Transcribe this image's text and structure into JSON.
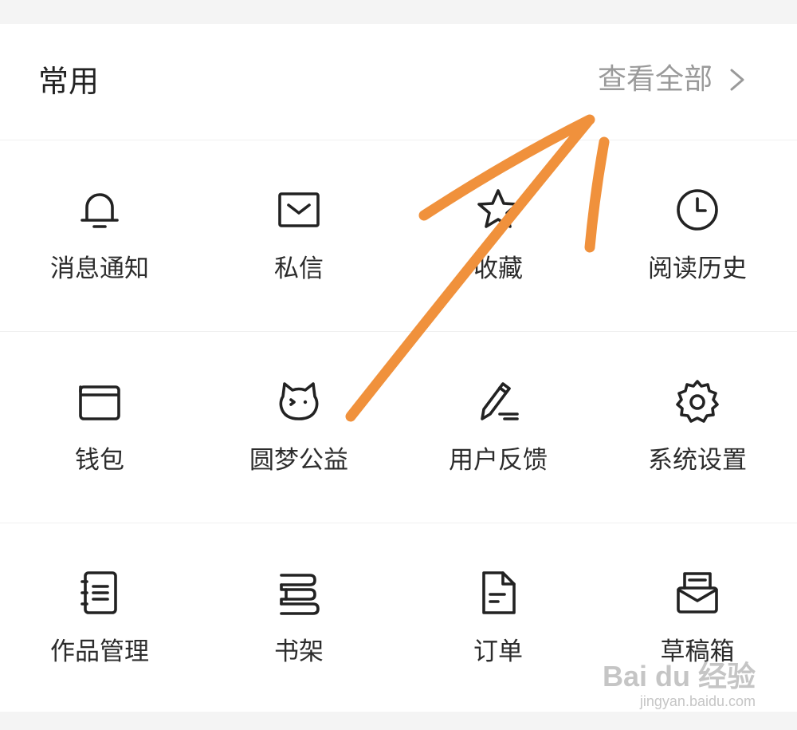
{
  "header": {
    "title": "常用",
    "view_all_label": "查看全部"
  },
  "grid": {
    "row1": [
      {
        "label": "消息通知",
        "icon": "bell-icon"
      },
      {
        "label": "私信",
        "icon": "mail-icon"
      },
      {
        "label": "收藏",
        "icon": "star-icon"
      },
      {
        "label": "阅读历史",
        "icon": "clock-icon"
      }
    ],
    "row2": [
      {
        "label": "钱包",
        "icon": "wallet-icon"
      },
      {
        "label": "圆梦公益",
        "icon": "cat-face-icon"
      },
      {
        "label": "用户反馈",
        "icon": "pencil-icon"
      },
      {
        "label": "系统设置",
        "icon": "gear-icon"
      }
    ],
    "row3": [
      {
        "label": "作品管理",
        "icon": "notebook-icon"
      },
      {
        "label": "书架",
        "icon": "bookshelf-icon"
      },
      {
        "label": "订单",
        "icon": "document-icon"
      },
      {
        "label": "草稿箱",
        "icon": "draft-box-icon"
      }
    ]
  },
  "annotation": {
    "color": "#f0913c",
    "icon": "hand-drawn-arrow"
  },
  "watermark": {
    "logo": "Bai du 经验",
    "url": "jingyan.baidu.com"
  },
  "colors": {
    "background": "#f4f4f4",
    "card": "#ffffff",
    "text": "#222222",
    "muted_text": "#9a9a9a"
  }
}
